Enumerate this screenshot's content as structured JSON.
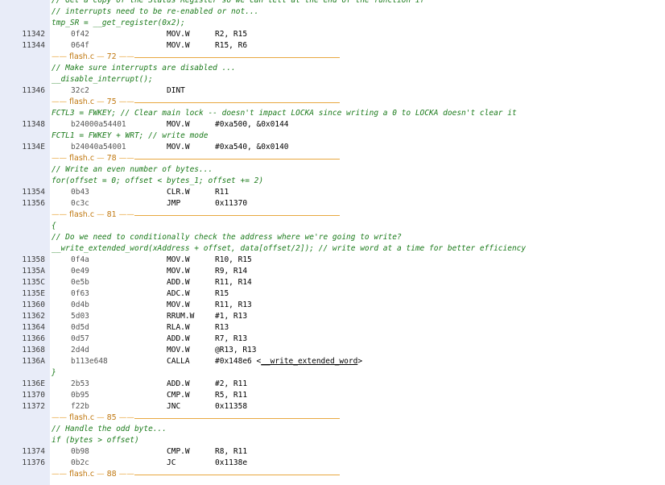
{
  "rows": [
    {
      "kind": "c",
      "text": "// Get a copy of the Status Register so we can tell at the end of the function if"
    },
    {
      "kind": "c",
      "text": "// interrupts need to be re-enabled or not..."
    },
    {
      "kind": "c",
      "text": "tmp_SR = __get_register(0x2);"
    },
    {
      "kind": "i",
      "addr": "11342",
      "hex": "0f42",
      "mn": "MOV.W",
      "op": "R2, R15"
    },
    {
      "kind": "i",
      "addr": "11344",
      "hex": "064f",
      "mn": "MOV.W",
      "op": "R15, R6"
    },
    {
      "kind": "s",
      "file": "flash.c",
      "line": "72"
    },
    {
      "kind": "c",
      "text": "// Make sure interrupts are disabled ..."
    },
    {
      "kind": "c",
      "text": "__disable_interrupt();"
    },
    {
      "kind": "i",
      "addr": "11346",
      "hex": "32c2",
      "mn": "DINT",
      "op": ""
    },
    {
      "kind": "s",
      "file": "flash.c",
      "line": "75"
    },
    {
      "kind": "c",
      "text": "FCTL3 = FWKEY; // Clear main lock -- doesn't impact LOCKA since writing a 0 to LOCKA doesn't clear it"
    },
    {
      "kind": "i",
      "addr": "11348",
      "hex": "b24000a54401",
      "mn": "MOV.W",
      "op": "#0xa500, &0x0144"
    },
    {
      "kind": "c",
      "text": "FCTL1 = FWKEY + WRT; // write mode"
    },
    {
      "kind": "i",
      "addr": "1134E",
      "hex": "b24040a54001",
      "mn": "MOV.W",
      "op": "#0xa540, &0x0140"
    },
    {
      "kind": "s",
      "file": "flash.c",
      "line": "78"
    },
    {
      "kind": "c",
      "text": "// Write an even number of bytes..."
    },
    {
      "kind": "c",
      "text": "for(offset = 0; offset < bytes_1; offset += 2)"
    },
    {
      "kind": "i",
      "addr": "11354",
      "hex": "0b43",
      "mn": "CLR.W",
      "op": "R11"
    },
    {
      "kind": "i",
      "addr": "11356",
      "hex": "0c3c",
      "mn": "JMP",
      "op": "0x11370"
    },
    {
      "kind": "s",
      "file": "flash.c",
      "line": "81"
    },
    {
      "kind": "c",
      "text": "{"
    },
    {
      "kind": "c",
      "text": "// Do we need to conditionally check the address where we're going to write?"
    },
    {
      "kind": "c",
      "text": "__write_extended_word(xAddress + offset, data[offset/2]); // write word at a time for better efficiency"
    },
    {
      "kind": "i",
      "addr": "11358",
      "hex": "0f4a",
      "mn": "MOV.W",
      "op": "R10, R15"
    },
    {
      "kind": "i",
      "addr": "1135A",
      "hex": "0e49",
      "mn": "MOV.W",
      "op": "R9, R14"
    },
    {
      "kind": "i",
      "addr": "1135C",
      "hex": "0e5b",
      "mn": "ADD.W",
      "op": "R11, R14"
    },
    {
      "kind": "i",
      "addr": "1135E",
      "hex": "0f63",
      "mn": "ADC.W",
      "op": "R15"
    },
    {
      "kind": "i",
      "addr": "11360",
      "hex": "0d4b",
      "mn": "MOV.W",
      "op": "R11, R13"
    },
    {
      "kind": "i",
      "addr": "11362",
      "hex": "5d03",
      "mn": "RRUM.W",
      "op": "#1, R13"
    },
    {
      "kind": "i",
      "addr": "11364",
      "hex": "0d5d",
      "mn": "RLA.W",
      "op": "R13"
    },
    {
      "kind": "i",
      "addr": "11366",
      "hex": "0d57",
      "mn": "ADD.W",
      "op": "R7, R13"
    },
    {
      "kind": "i",
      "addr": "11368",
      "hex": "2d4d",
      "mn": "MOV.W",
      "op": "@R13, R13"
    },
    {
      "kind": "i",
      "addr": "1136A",
      "hex": "b113e648",
      "mn": "CALLA",
      "op": "#0x148e6 <",
      "link": "__write_extended_word",
      "after": ">"
    },
    {
      "kind": "c",
      "text": "}"
    },
    {
      "kind": "i",
      "addr": "1136E",
      "hex": "2b53",
      "mn": "ADD.W",
      "op": "#2, R11"
    },
    {
      "kind": "i",
      "addr": "11370",
      "hex": "0b95",
      "mn": "CMP.W",
      "op": "R5, R11"
    },
    {
      "kind": "i",
      "addr": "11372",
      "hex": "f22b",
      "mn": "JNC",
      "op": "0x11358"
    },
    {
      "kind": "s",
      "file": "flash.c",
      "line": "85"
    },
    {
      "kind": "c",
      "text": "// Handle the odd byte..."
    },
    {
      "kind": "c",
      "text": "if (bytes > offset)"
    },
    {
      "kind": "i",
      "addr": "11374",
      "hex": "0b98",
      "mn": "CMP.W",
      "op": "R8, R11"
    },
    {
      "kind": "i",
      "addr": "11376",
      "hex": "0b2c",
      "mn": "JC",
      "op": "0x1138e"
    },
    {
      "kind": "s",
      "file": "flash.c",
      "line": "88"
    }
  ]
}
